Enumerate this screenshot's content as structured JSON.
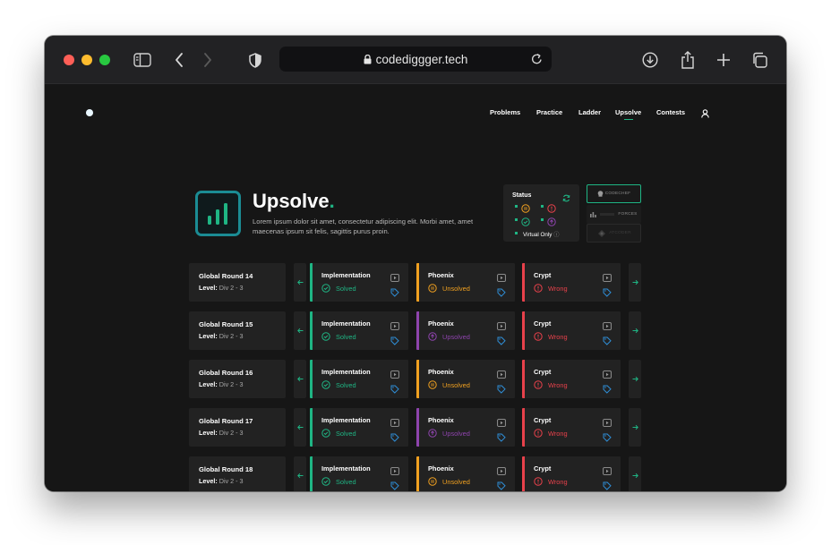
{
  "browser": {
    "url": "codediggger.tech"
  },
  "nav": {
    "items": [
      {
        "label": "Problems"
      },
      {
        "label": "Practice"
      },
      {
        "label": "Ladder"
      },
      {
        "label": "Upsolve",
        "active": true
      },
      {
        "label": "Contests"
      }
    ]
  },
  "hero": {
    "title": "Upsolve",
    "dot": ".",
    "description": "Lorem ipsum dolor sit amet, consectetur adipiscing elit. Morbi amet, amet maecenas ipsum sit felis, sagittis purus proin."
  },
  "status_card": {
    "title": "Status",
    "virtual_label": "Virtual Only",
    "legend_icons": [
      "pause-circle-icon",
      "alert-circle-icon",
      "check-circle-icon",
      "arrow-up-circle-icon"
    ]
  },
  "platforms": [
    {
      "label": "CODECHEF",
      "selected": true
    },
    {
      "label": "FORCES",
      "selected": false
    },
    {
      "label": "ATCODER",
      "selected": false
    }
  ],
  "colors": {
    "accent": "#1fb584",
    "solved": "#1fb584",
    "unsolved": "#f0a020",
    "upsolved": "#8e44ad",
    "wrong": "#e8414b",
    "tag": "#2f8fd8",
    "card_bg": "#222222",
    "page_bg": "#161616"
  },
  "rounds": [
    {
      "title": "Global Round 14",
      "level_label": "Level",
      "level": "Div 2 - 3",
      "problems": [
        {
          "name": "Implementation",
          "status": "Solved",
          "kind": "solved"
        },
        {
          "name": "Phoenix",
          "status": "Unsolved",
          "kind": "unsolved"
        },
        {
          "name": "Crypt",
          "status": "Wrong",
          "kind": "wrong"
        }
      ]
    },
    {
      "title": "Global Round 15",
      "level_label": "Level",
      "level": "Div 2 - 3",
      "problems": [
        {
          "name": "Implementation",
          "status": "Solved",
          "kind": "solved"
        },
        {
          "name": "Phoenix",
          "status": "Upsolved",
          "kind": "upsolved"
        },
        {
          "name": "Crypt",
          "status": "Wrong",
          "kind": "wrong"
        }
      ]
    },
    {
      "title": "Global Round 16",
      "level_label": "Level",
      "level": "Div 2 - 3",
      "problems": [
        {
          "name": "Implementation",
          "status": "Solved",
          "kind": "solved"
        },
        {
          "name": "Phoenix",
          "status": "Unsolved",
          "kind": "unsolved"
        },
        {
          "name": "Crypt",
          "status": "Wrong",
          "kind": "wrong"
        }
      ]
    },
    {
      "title": "Global Round 17",
      "level_label": "Level",
      "level": "Div 2 - 3",
      "problems": [
        {
          "name": "Implementation",
          "status": "Solved",
          "kind": "solved"
        },
        {
          "name": "Phoenix",
          "status": "Upsolved",
          "kind": "upsolved"
        },
        {
          "name": "Crypt",
          "status": "Wrong",
          "kind": "wrong"
        }
      ]
    },
    {
      "title": "Global Round 18",
      "level_label": "Level",
      "level": "Div 2 - 3",
      "problems": [
        {
          "name": "Implementation",
          "status": "Solved",
          "kind": "solved"
        },
        {
          "name": "Phoenix",
          "status": "Unsolved",
          "kind": "unsolved"
        },
        {
          "name": "Crypt",
          "status": "Wrong",
          "kind": "wrong"
        }
      ]
    }
  ]
}
